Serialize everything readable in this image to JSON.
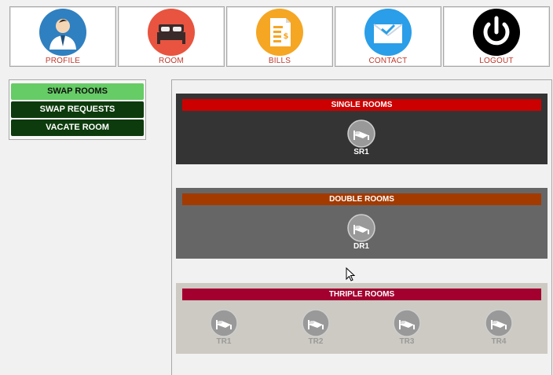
{
  "nav": [
    {
      "label": "PROFILE",
      "icon": "user-icon"
    },
    {
      "label": "ROOM",
      "icon": "bed-icon"
    },
    {
      "label": "BILLS",
      "icon": "bill-icon"
    },
    {
      "label": "CONTACT",
      "icon": "mail-icon"
    },
    {
      "label": "LOGOUT",
      "icon": "power-icon"
    }
  ],
  "side_menu": [
    {
      "label": "SWAP ROOMS",
      "active": true
    },
    {
      "label": "SWAP REQUESTS",
      "active": false
    },
    {
      "label": "VACATE ROOM",
      "active": false
    }
  ],
  "blocks": [
    {
      "title": "SINGLE ROOMS",
      "header_color": "#cc0000",
      "bg_color": "#343434",
      "rooms": [
        "SR1"
      ]
    },
    {
      "title": "DOUBLE ROOMS",
      "header_color": "#a33a00",
      "bg_color": "#666666",
      "rooms": [
        "DR1"
      ]
    },
    {
      "title": "THRIPLE ROOMS",
      "header_color": "#a3002f",
      "bg_color": "#cccac2",
      "rooms": [
        "TR1",
        "TR2",
        "TR3",
        "TR4"
      ]
    }
  ],
  "colors": {
    "nav_label": "#c0392b",
    "menu_active": "#66cc66",
    "menu_dark": "#0d3b0d"
  }
}
